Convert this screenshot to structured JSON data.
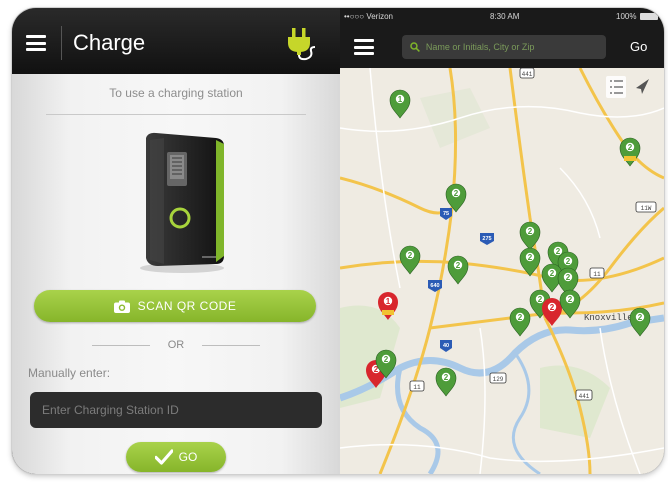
{
  "left_panel": {
    "title": "Charge",
    "instruction": "To use a charging station",
    "scan_button_label": "SCAN QR CODE",
    "or_label": "OR",
    "manual_label": "Manually enter:",
    "station_input_placeholder": "Enter Charging Station ID",
    "station_input_value": "",
    "go_button_label": "GO",
    "header_icon": "plug-icon"
  },
  "right_panel": {
    "status": {
      "carrier": "••○○○ Verizon",
      "time": "8:30 AM",
      "battery": "100%"
    },
    "search_placeholder": "Name or Initials, City or Zip",
    "go_label": "Go",
    "city_label": "Knoxville",
    "pins": [
      {
        "label": "1",
        "kind": "green"
      },
      {
        "label": "2",
        "kind": "green"
      },
      {
        "label": "2",
        "kind": "green-tools"
      },
      {
        "label": "2",
        "kind": "green"
      },
      {
        "label": "2",
        "kind": "green"
      },
      {
        "label": "2",
        "kind": "green"
      },
      {
        "label": "2",
        "kind": "green"
      },
      {
        "label": "2",
        "kind": "green"
      },
      {
        "label": "2",
        "kind": "green"
      },
      {
        "label": "2",
        "kind": "green"
      },
      {
        "label": "2",
        "kind": "green"
      },
      {
        "label": "2",
        "kind": "green"
      },
      {
        "label": "1",
        "kind": "red-tools"
      },
      {
        "label": "2",
        "kind": "red"
      },
      {
        "label": "2",
        "kind": "red"
      },
      {
        "label": "2",
        "kind": "green"
      },
      {
        "label": "2",
        "kind": "green"
      },
      {
        "label": "2",
        "kind": "green"
      },
      {
        "label": "2",
        "kind": "green"
      },
      {
        "label": "2",
        "kind": "green"
      }
    ],
    "route_shields": [
      "441",
      "75",
      "275",
      "640",
      "40",
      "11",
      "129",
      "441",
      "11",
      "11W"
    ]
  },
  "colors": {
    "accent_green": "#8dbb2f",
    "pin_green": "#4e9c3a",
    "pin_red": "#d8262d",
    "header_dark": "#1a1a1a",
    "plug_yellow": "#c6d62a"
  }
}
